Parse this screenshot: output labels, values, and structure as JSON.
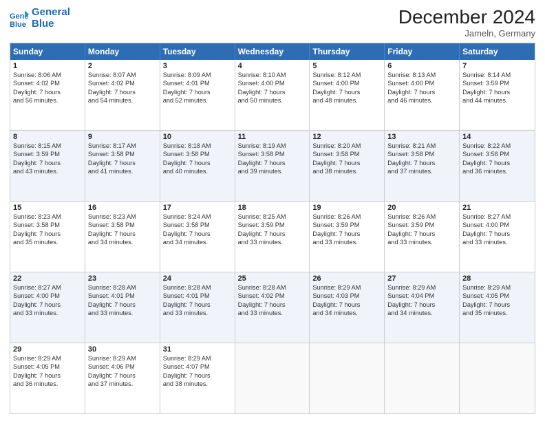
{
  "header": {
    "logo_line1": "General",
    "logo_line2": "Blue",
    "title": "December 2024",
    "subtitle": "Jameln, Germany"
  },
  "days": [
    "Sunday",
    "Monday",
    "Tuesday",
    "Wednesday",
    "Thursday",
    "Friday",
    "Saturday"
  ],
  "weeks": [
    [
      {
        "day": "1",
        "lines": [
          "Sunrise: 8:06 AM",
          "Sunset: 4:02 PM",
          "Daylight: 7 hours",
          "and 56 minutes."
        ]
      },
      {
        "day": "2",
        "lines": [
          "Sunrise: 8:07 AM",
          "Sunset: 4:02 PM",
          "Daylight: 7 hours",
          "and 54 minutes."
        ]
      },
      {
        "day": "3",
        "lines": [
          "Sunrise: 8:09 AM",
          "Sunset: 4:01 PM",
          "Daylight: 7 hours",
          "and 52 minutes."
        ]
      },
      {
        "day": "4",
        "lines": [
          "Sunrise: 8:10 AM",
          "Sunset: 4:00 PM",
          "Daylight: 7 hours",
          "and 50 minutes."
        ]
      },
      {
        "day": "5",
        "lines": [
          "Sunrise: 8:12 AM",
          "Sunset: 4:00 PM",
          "Daylight: 7 hours",
          "and 48 minutes."
        ]
      },
      {
        "day": "6",
        "lines": [
          "Sunrise: 8:13 AM",
          "Sunset: 4:00 PM",
          "Daylight: 7 hours",
          "and 46 minutes."
        ]
      },
      {
        "day": "7",
        "lines": [
          "Sunrise: 8:14 AM",
          "Sunset: 3:59 PM",
          "Daylight: 7 hours",
          "and 44 minutes."
        ]
      }
    ],
    [
      {
        "day": "8",
        "lines": [
          "Sunrise: 8:15 AM",
          "Sunset: 3:59 PM",
          "Daylight: 7 hours",
          "and 43 minutes."
        ]
      },
      {
        "day": "9",
        "lines": [
          "Sunrise: 8:17 AM",
          "Sunset: 3:58 PM",
          "Daylight: 7 hours",
          "and 41 minutes."
        ]
      },
      {
        "day": "10",
        "lines": [
          "Sunrise: 8:18 AM",
          "Sunset: 3:58 PM",
          "Daylight: 7 hours",
          "and 40 minutes."
        ]
      },
      {
        "day": "11",
        "lines": [
          "Sunrise: 8:19 AM",
          "Sunset: 3:58 PM",
          "Daylight: 7 hours",
          "and 39 minutes."
        ]
      },
      {
        "day": "12",
        "lines": [
          "Sunrise: 8:20 AM",
          "Sunset: 3:58 PM",
          "Daylight: 7 hours",
          "and 38 minutes."
        ]
      },
      {
        "day": "13",
        "lines": [
          "Sunrise: 8:21 AM",
          "Sunset: 3:58 PM",
          "Daylight: 7 hours",
          "and 37 minutes."
        ]
      },
      {
        "day": "14",
        "lines": [
          "Sunrise: 8:22 AM",
          "Sunset: 3:58 PM",
          "Daylight: 7 hours",
          "and 36 minutes."
        ]
      }
    ],
    [
      {
        "day": "15",
        "lines": [
          "Sunrise: 8:23 AM",
          "Sunset: 3:58 PM",
          "Daylight: 7 hours",
          "and 35 minutes."
        ]
      },
      {
        "day": "16",
        "lines": [
          "Sunrise: 8:23 AM",
          "Sunset: 3:58 PM",
          "Daylight: 7 hours",
          "and 34 minutes."
        ]
      },
      {
        "day": "17",
        "lines": [
          "Sunrise: 8:24 AM",
          "Sunset: 3:58 PM",
          "Daylight: 7 hours",
          "and 34 minutes."
        ]
      },
      {
        "day": "18",
        "lines": [
          "Sunrise: 8:25 AM",
          "Sunset: 3:59 PM",
          "Daylight: 7 hours",
          "and 33 minutes."
        ]
      },
      {
        "day": "19",
        "lines": [
          "Sunrise: 8:26 AM",
          "Sunset: 3:59 PM",
          "Daylight: 7 hours",
          "and 33 minutes."
        ]
      },
      {
        "day": "20",
        "lines": [
          "Sunrise: 8:26 AM",
          "Sunset: 3:59 PM",
          "Daylight: 7 hours",
          "and 33 minutes."
        ]
      },
      {
        "day": "21",
        "lines": [
          "Sunrise: 8:27 AM",
          "Sunset: 4:00 PM",
          "Daylight: 7 hours",
          "and 33 minutes."
        ]
      }
    ],
    [
      {
        "day": "22",
        "lines": [
          "Sunrise: 8:27 AM",
          "Sunset: 4:00 PM",
          "Daylight: 7 hours",
          "and 33 minutes."
        ]
      },
      {
        "day": "23",
        "lines": [
          "Sunrise: 8:28 AM",
          "Sunset: 4:01 PM",
          "Daylight: 7 hours",
          "and 33 minutes."
        ]
      },
      {
        "day": "24",
        "lines": [
          "Sunrise: 8:28 AM",
          "Sunset: 4:01 PM",
          "Daylight: 7 hours",
          "and 33 minutes."
        ]
      },
      {
        "day": "25",
        "lines": [
          "Sunrise: 8:28 AM",
          "Sunset: 4:02 PM",
          "Daylight: 7 hours",
          "and 33 minutes."
        ]
      },
      {
        "day": "26",
        "lines": [
          "Sunrise: 8:29 AM",
          "Sunset: 4:03 PM",
          "Daylight: 7 hours",
          "and 34 minutes."
        ]
      },
      {
        "day": "27",
        "lines": [
          "Sunrise: 8:29 AM",
          "Sunset: 4:04 PM",
          "Daylight: 7 hours",
          "and 34 minutes."
        ]
      },
      {
        "day": "28",
        "lines": [
          "Sunrise: 8:29 AM",
          "Sunset: 4:05 PM",
          "Daylight: 7 hours",
          "and 35 minutes."
        ]
      }
    ],
    [
      {
        "day": "29",
        "lines": [
          "Sunrise: 8:29 AM",
          "Sunset: 4:05 PM",
          "Daylight: 7 hours",
          "and 36 minutes."
        ]
      },
      {
        "day": "30",
        "lines": [
          "Sunrise: 8:29 AM",
          "Sunset: 4:06 PM",
          "Daylight: 7 hours",
          "and 37 minutes."
        ]
      },
      {
        "day": "31",
        "lines": [
          "Sunrise: 8:29 AM",
          "Sunset: 4:07 PM",
          "Daylight: 7 hours",
          "and 38 minutes."
        ]
      },
      null,
      null,
      null,
      null
    ]
  ]
}
